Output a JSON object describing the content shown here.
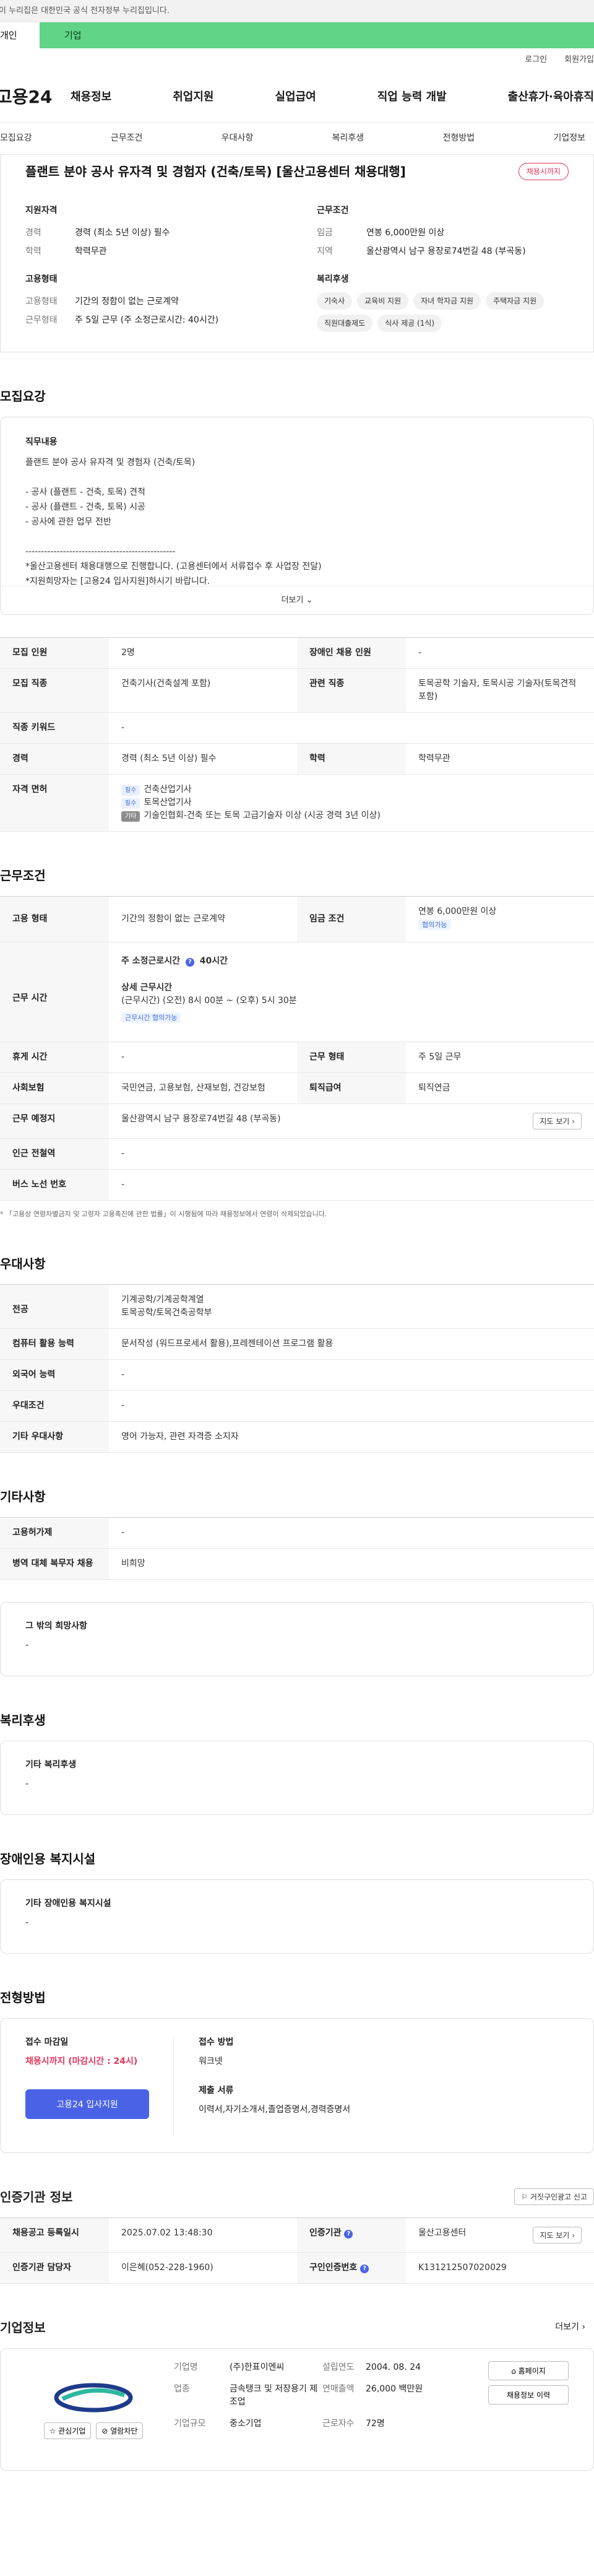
{
  "gov_banner": "이 누리집은 대한민국 공식 전자정부 누리집입니다.",
  "persona": {
    "personal": "개인",
    "corp": "기업"
  },
  "util": {
    "login": "로그인",
    "join": "회원가입"
  },
  "gnb": {
    "logo": "고용24",
    "menu": [
      "채용정보",
      "취업지원",
      "실업급여",
      "직업 능력 개발",
      "출산휴가·육아휴직"
    ]
  },
  "anchors": [
    "모집요강",
    "근무조건",
    "우대사항",
    "복리후생",
    "전형방법",
    "기업정보"
  ],
  "summary": {
    "title": "플랜트 분야 공사 유자격 및 경험자 (건축/토목) [울산고용센터 채용대행]",
    "badge": "채용시까지",
    "qual_title": "지원자격",
    "career_k": "경력",
    "career_v": "경력 (최소 5년 이상) 필수",
    "edu_k": "학력",
    "edu_v": "학력무관",
    "cond_title": "근무조건",
    "wage_k": "임금",
    "wage_v": "연봉 6,000만원 이상",
    "region_k": "지역",
    "region_v": "울산광역시 남구 용장로74번길 48 (부곡동)",
    "emp_title": "고용형태",
    "emptype_k": "고용형태",
    "emptype_v": "기간의 정함이 없는 근로계약",
    "workdays_k": "근무형태",
    "workdays_v": "주 5일 근무 (주 소정근로시간: 40시간)",
    "welfare_title": "복리후생",
    "chips": [
      "기숙사",
      "교육비 지원",
      "자녀 학자금 지원",
      "주택자금 지원",
      "직원대출제도",
      "식사 제공 (1식)"
    ]
  },
  "recruit": {
    "section": "모집요강",
    "job_title": "직무내용",
    "job_text": "플랜트 분야 공사 유자격 및 경험자 (건축/토목)\n\n- 공사 (플랜트 - 건축, 토목) 견적\n- 공사 (플랜트 - 건축, 토목) 시공\n- 공사에 관한 업무 전반\n\n------------------------------------------------\n*울산고용센터 채용대행으로 진행합니다. (고용센터에서 서류접수 후 사업장 전달)\n*지원희망자는 [고용24 입사지원]하시기 바랍니다.",
    "more": "더보기",
    "rows": {
      "headcount_k": "모집 인원",
      "headcount_v": "2명",
      "disabled_k": "장애인 채용 인원",
      "disabled_v": "-",
      "job_k": "모집 직종",
      "job_v": "건축기사(건축설계 포함)",
      "related_k": "관련 직종",
      "related_v": "토목공학 기술자, 토목시공 기술자(토목견적 포함)",
      "keyword_k": "직종 키워드",
      "keyword_v": "-",
      "career_k": "경력",
      "career_v": "경력 (최소 5년 이상) 필수",
      "edu_k": "학력",
      "edu_v": "학력무관",
      "license_k": "자격 면허",
      "lic1_tag": "필수",
      "lic1": "건축산업기사",
      "lic2_tag": "필수",
      "lic2": "토목산업기사",
      "lic3_tag": "기타",
      "lic3": "기술인협회-건축 또는 토목 고급기술자 이상 (시공 경력 3년 이상)"
    }
  },
  "work": {
    "section": "근무조건",
    "emptype_k": "고용 형태",
    "emptype_v": "기간의 정함이 없는 근로계약",
    "wage_k": "임금 조건",
    "wage_v": "연봉 6,000만원 이상",
    "wage_tag": "협의가능",
    "hours_k": "근무 시간",
    "hours_main": "주 소정근로시간",
    "hours_num": "40시간",
    "hours_detail_title": "상세 근무시간",
    "hours_detail": "(근무시간) (오전) 8시 00분 ~ (오후) 5시 30분",
    "hours_tag": "근무시간 협의가능",
    "break_k": "휴게 시간",
    "break_v": "-",
    "shape_k": "근무 형태",
    "shape_v": "주 5일 근무",
    "insure_k": "사회보험",
    "insure_v": "국민연금, 고용보험, 산재보험, 건강보험",
    "retire_k": "퇴직급여",
    "retire_v": "퇴직연금",
    "place_k": "근무 예정지",
    "place_v": "울산광역시 남구 용장로74번길 48 (부곡동)",
    "map_btn": "지도 보기",
    "subway_k": "인근 전철역",
    "subway_v": "-",
    "bus_k": "버스 노선 번호",
    "bus_v": "-",
    "note": "* 「고용상 연령차별금지 및 고령자 고용촉진에 관한 법률」이 시행됨에 따라 채용정보에서 연령이 삭제되었습니다."
  },
  "pref": {
    "section": "우대사항",
    "major_k": "전공",
    "major_v1": "기계공학/기계공학계열",
    "major_v2": "토목공학/토목건축공학부",
    "pc_k": "컴퓨터 활용 능력",
    "pc_v": "문서작성 (워드프로세서 활용),프레젠테이션 프로그램 활용",
    "lang_k": "외국어 능력",
    "lang_v": "-",
    "cond_k": "우대조건",
    "cond_v": "-",
    "etc_k": "기타 우대사항",
    "etc_v": "영어 가능자, 관련 자격증 소지자"
  },
  "etc": {
    "section": "기타사항",
    "support_k": "고용허가제",
    "support_v": "-",
    "military_k": "병역 대체 복무자 채용",
    "military_v": "비희망",
    "hope_title": "그 밖의 희망사항",
    "hope_v": "-"
  },
  "welfare": {
    "section": "복리후생",
    "title": "기타 복리후생",
    "v": "-"
  },
  "disabled": {
    "section": "장애인용 복지시설",
    "title": "기타 장애인용 복지시설",
    "v": "-"
  },
  "apply": {
    "section": "전형방법",
    "deadline_title": "접수 마감일",
    "deadline_v": "채용시까지 (마감시간 : 24시)",
    "btn": "고용24 입사지원",
    "method_title": "접수 방법",
    "method_v": "워크넷",
    "docs_title": "제출 서류",
    "docs_v": "이력서,자기소개서,졸업증명서,경력증명서"
  },
  "cert": {
    "section": "인증기관 정보",
    "report_btn": "거짓구인광고 신고",
    "reg_k": "채용공고 등록일시",
    "reg_v": "2025.07.02 13:48:30",
    "org_k": "인증기관",
    "org_v": "울산고용센터",
    "map_btn": "지도 보기",
    "staff_k": "인증기관 담당자",
    "staff_v": "이은혜(052-228-1960)",
    "id_k": "구인인증번호",
    "id_v": "K131212507020029"
  },
  "company": {
    "section": "기업정보",
    "more": "더보기",
    "fav_btn": "관심기업",
    "block_btn": "열람차단",
    "name_k": "기업명",
    "name_v": "(주)한표이엔씨",
    "year_k": "설립연도",
    "year_v": "2004. 08. 24",
    "ind_k": "업종",
    "ind_v": "금속탱크 및 저장용기 제조업",
    "sales_k": "연매출액",
    "sales_v": "26,000 백만원",
    "staff_k": "근로자수",
    "staff_v": "72명",
    "scale_k": "기업규모",
    "scale_v": "중소기업",
    "home_btn": "홈페이지",
    "more_btn": "채용정보 이력"
  },
  "colors": {
    "accent": "#4a63e6",
    "corp_tab": "#62d487",
    "deadline": "#e5345b"
  }
}
